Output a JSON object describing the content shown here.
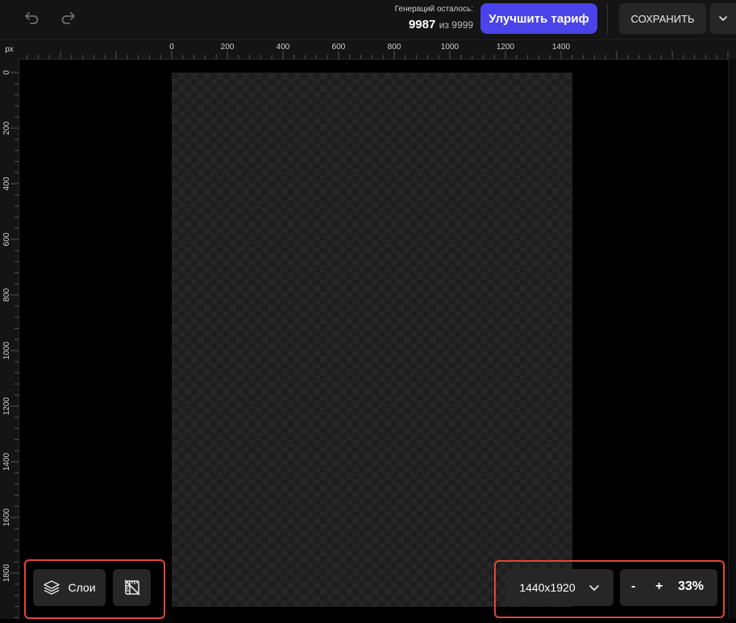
{
  "toolbar": {
    "undo_icon": "undo-icon",
    "redo_icon": "redo-icon",
    "generations_label": "Генераций осталось:",
    "generations_used": "9987",
    "generations_of": "из 9999",
    "upgrade_label": "Улучшить тариф",
    "save_label": "СОХРАНИТЬ",
    "save_more_icon": "chevron-down-icon"
  },
  "rulers": {
    "unit": "px",
    "top_ticks": [
      "0",
      "200",
      "400",
      "600",
      "800",
      "1000",
      "1200",
      "1400"
    ],
    "left_ticks": [
      "0",
      "200",
      "400",
      "600",
      "800",
      "1000",
      "1200",
      "1400",
      "1600",
      "1800"
    ]
  },
  "bottom_left": {
    "layers_label": "Слои",
    "layers_icon": "layers-icon",
    "ruler_toggle_icon": "ruler-off-icon"
  },
  "bottom_right": {
    "canvas_size": "1440x1920",
    "zoom_out": "-",
    "zoom_in": "+",
    "zoom_level": "33%"
  },
  "colors": {
    "accent": "#4a43ea",
    "highlight": "#e5443d"
  }
}
